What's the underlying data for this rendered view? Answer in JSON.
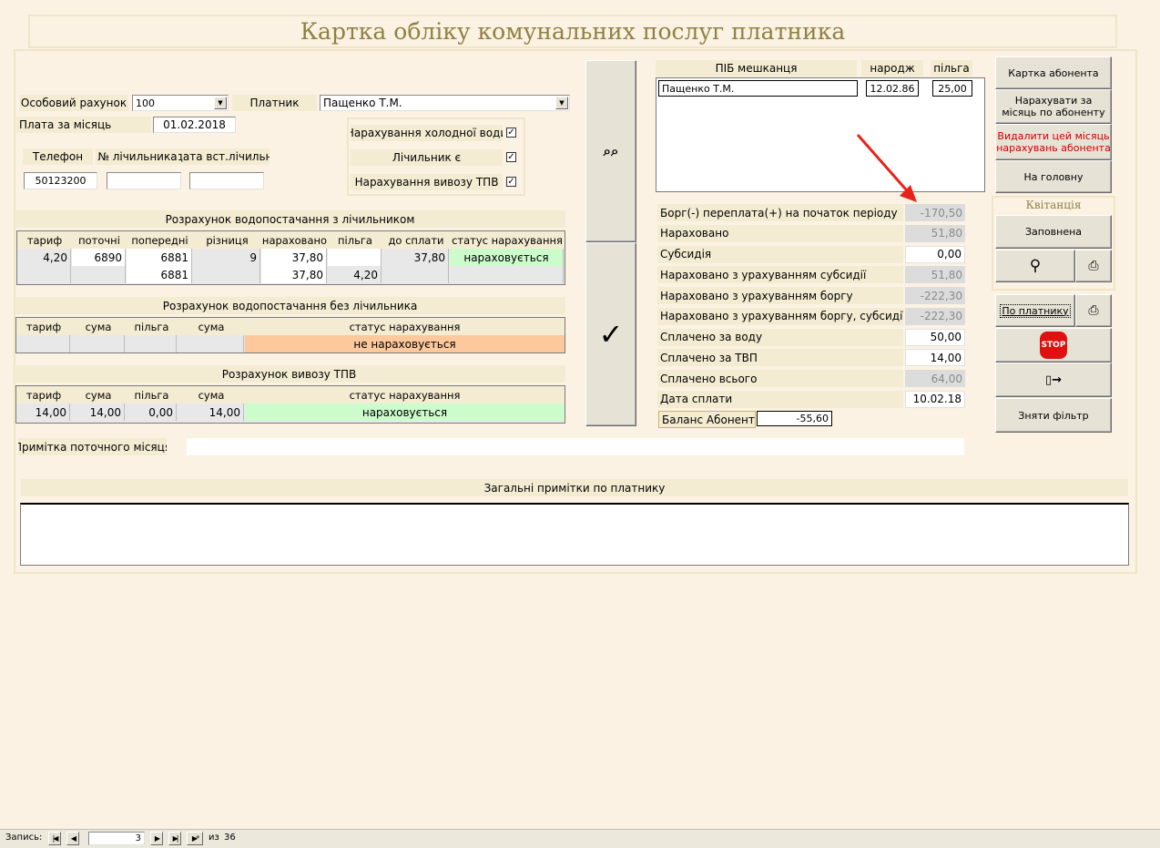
{
  "title": "Картка обліку комунальних послуг платника",
  "account": {
    "label": "Особовий рахунок",
    "value": "100"
  },
  "payer": {
    "label": "Платник",
    "value": "Пащенко Т.М."
  },
  "month": {
    "label": "Плата за місяць",
    "value": "01.02.2018"
  },
  "phone": {
    "label": "Телефон",
    "value": "50123200"
  },
  "meter_no_label": "№ лічильника",
  "meter_date_label": "дата вст.лічильн",
  "checks": {
    "cold_water": "Нарахування холодної води",
    "meter": "Лічильник є",
    "tpv": "Нарахування вивозу ТПВ",
    "mark": "✓"
  },
  "meter_calc": {
    "title": "Розрахунок водопостачання з лічильником",
    "headers": [
      "тариф",
      "поточні",
      "попередні",
      "різниця",
      "нараховано",
      "пільга",
      "до сплати",
      "статус нарахування"
    ],
    "row1": [
      "4,20",
      "6890",
      "6881",
      "9",
      "37,80",
      "",
      "37,80",
      "нараховується"
    ],
    "row2": [
      "",
      "",
      "6881",
      "",
      "37,80",
      "4,20",
      "",
      ""
    ]
  },
  "nometer_calc": {
    "title": "Розрахунок водопостачання без лічильника",
    "headers": [
      "тариф",
      "сума",
      "пільга",
      "сума",
      "статус нарахування"
    ],
    "status": "не нараховується"
  },
  "tpv_calc": {
    "title": "Розрахунок вивозу ТПВ",
    "headers": [
      "тариф",
      "сума",
      "пільга",
      "сума",
      "статус нарахування"
    ],
    "row": [
      "14,00",
      "14,00",
      "0,00",
      "14,00",
      "нараховується"
    ]
  },
  "note_month_label": "Примітка поточного місяця",
  "general_notes_label": "Загальні примітки по платнику",
  "residents": {
    "headers": [
      "ПІБ мешканця",
      "народж",
      "пільга"
    ],
    "row": [
      "Пащенко Т.М.",
      "12.02.86",
      "25,00"
    ]
  },
  "summary": [
    {
      "label": "Борг(-) переплата(+) на початок періоду",
      "value": "-170,50"
    },
    {
      "label": "Нараховано",
      "value": "51,80"
    },
    {
      "label": "Субсидія",
      "value": "0,00"
    },
    {
      "label": "Нараховано з урахуванням субсидії",
      "value": "51,80"
    },
    {
      "label": "Нараховано з урахуванням боргу",
      "value": "-222,30"
    },
    {
      "label": "Нараховано з урахуванням боргу, субсидії",
      "value": "-222,30"
    },
    {
      "label": "Сплачено за воду",
      "value": "50,00"
    },
    {
      "label": "Сплачено за ТВП",
      "value": "14,00"
    },
    {
      "label": "Сплачено всього",
      "value": "64,00"
    },
    {
      "label": "Дата сплати",
      "value": "10.02.18"
    }
  ],
  "balance": {
    "label": "Баланс Абонента",
    "value": "-55,60"
  },
  "buttons": {
    "card": "Картка абонента",
    "charge": "Нарахувати за місяць по абоненту",
    "delete": "Видалити цей місяць нарахувань абонента",
    "home": "На головну",
    "receipt": "Квітанція",
    "filled": "Заповнена",
    "by_payer": "По платнику",
    "stop": "STOP",
    "unfilter": "Зняти фільтр"
  },
  "colors": {
    "accent_title": "#8f8143",
    "delete_text": "#cc0000",
    "status_on": "#ccfccc",
    "status_off": "#fcc89c",
    "arrow": "#e8231a"
  },
  "nav": {
    "label": "Запись:",
    "current": "3",
    "of": "из",
    "total": "36"
  }
}
